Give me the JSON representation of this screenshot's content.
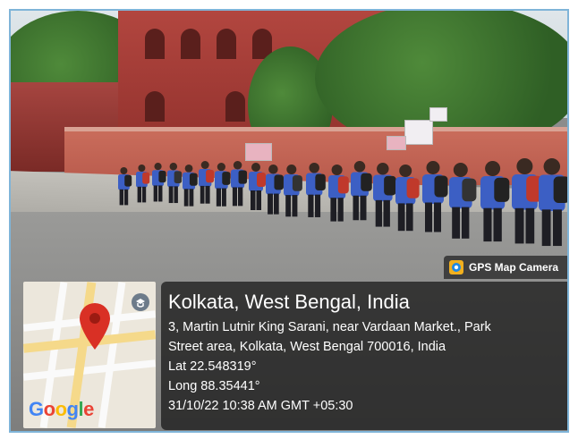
{
  "overlay": {
    "app_badge": "GPS Map Camera",
    "title": "Kolkata, West Bengal, India",
    "address_line1": "3, Martin Lutnir King Sarani, near Vardaan Market., Park",
    "address_line2": "Street area, Kolkata, West Bengal 700016, India",
    "latitude": "Lat 22.548319°",
    "longitude": "Long 88.35441°",
    "timestamp": "31/10/22 10:38 AM GMT +05:30"
  },
  "map": {
    "logo_text": "Google",
    "pin_color": "#d93025"
  },
  "colors": {
    "google_blue": "#4285f4",
    "google_red": "#ea4335",
    "google_yellow": "#fbbc05",
    "google_green": "#34a853",
    "frame_border": "#7fb4d8"
  },
  "icons": [
    "map-pin-icon",
    "camera-icon",
    "hint-icon"
  ]
}
